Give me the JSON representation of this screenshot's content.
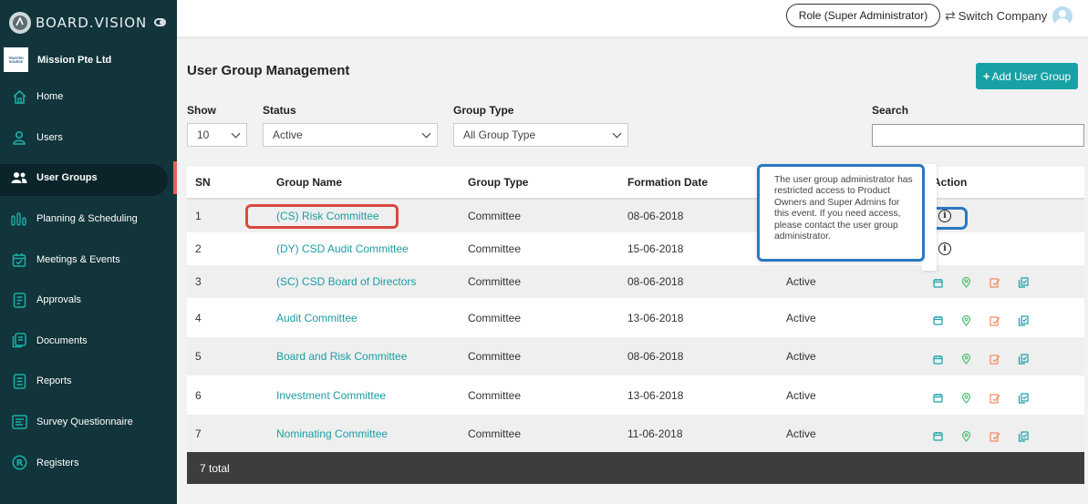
{
  "brand": {
    "name": "BOARD.VISION"
  },
  "company": {
    "logo_line1": "TRUSTED",
    "logo_line2": "SOURCE",
    "name": "Mission Pte Ltd"
  },
  "sidebar": {
    "items": [
      {
        "label": "Home",
        "icon": "home-icon"
      },
      {
        "label": "Users",
        "icon": "user-icon"
      },
      {
        "label": "User Groups",
        "icon": "users-icon",
        "active": true
      },
      {
        "label": "Planning & Scheduling",
        "icon": "bar-chart-icon"
      },
      {
        "label": "Meetings & Events",
        "icon": "calendar-check-icon"
      },
      {
        "label": "Approvals",
        "icon": "document-check-icon"
      },
      {
        "label": "Documents",
        "icon": "documents-icon"
      },
      {
        "label": "Reports",
        "icon": "report-icon"
      },
      {
        "label": "Survey Questionnaire",
        "icon": "survey-icon"
      },
      {
        "label": "Registers",
        "icon": "registered-icon"
      }
    ]
  },
  "header": {
    "role_label": "Role (Super Administrator)",
    "switch_company_label": "Switch Company"
  },
  "main": {
    "title": "User Group Management",
    "add_button_label": "Add User Group",
    "filters": {
      "show_label": "Show",
      "show_value": "10",
      "status_label": "Status",
      "status_value": "Active",
      "group_type_label": "Group Type",
      "group_type_value": "All Group Type",
      "search_label": "Search"
    },
    "table": {
      "headers": {
        "sn": "SN",
        "name": "Group Name",
        "type": "Group Type",
        "date": "Formation Date",
        "action": "Action"
      },
      "rows": [
        {
          "sn": "1",
          "name": "(CS) Risk Committee",
          "type": "Committee",
          "date": "08-06-2018",
          "status": "",
          "action": "info"
        },
        {
          "sn": "2",
          "name": "(DY) CSD Audit Committee",
          "type": "Committee",
          "date": "15-06-2018",
          "status": "",
          "action": "info"
        },
        {
          "sn": "3",
          "name": "(SC) CSD Board of Directors",
          "type": "Committee",
          "date": "08-06-2018",
          "status": "Active",
          "action": "icons"
        },
        {
          "sn": "4",
          "name": "Audit Committee",
          "type": "Committee",
          "date": "13-06-2018",
          "status": "Active",
          "action": "icons"
        },
        {
          "sn": "5",
          "name": "Board and Risk Committee",
          "type": "Committee",
          "date": "08-06-2018",
          "status": "Active",
          "action": "icons"
        },
        {
          "sn": "6",
          "name": "Investment Committee",
          "type": "Committee",
          "date": "13-06-2018",
          "status": "Active",
          "action": "icons"
        },
        {
          "sn": "7",
          "name": "Nominating Committee",
          "type": "Committee",
          "date": "11-06-2018",
          "status": "Active",
          "action": "icons"
        }
      ],
      "footer": "7 total"
    },
    "tooltip": "The user group administrator has restricted access to Product Owners and Super Admins for this event. If you need access, please contact the user group administrator."
  },
  "colors": {
    "sidebar": "#12343b",
    "accent": "#17a1a5",
    "highlight_red": "#d9493f",
    "highlight_blue": "#2a78c2",
    "footer": "#3d3d3d"
  }
}
